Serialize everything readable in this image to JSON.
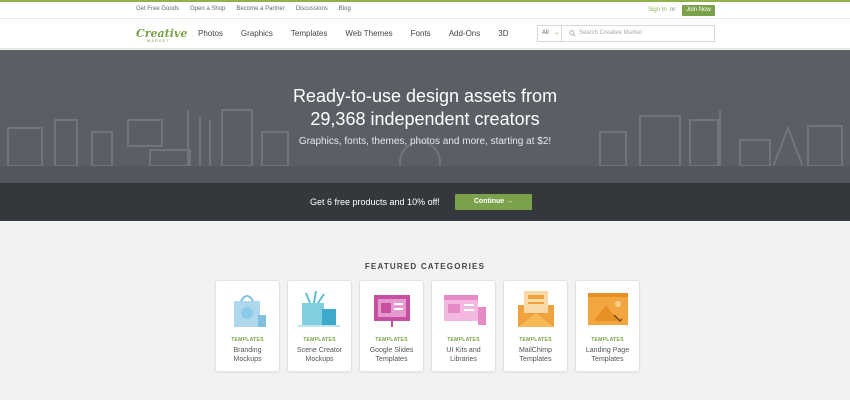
{
  "topbar": {
    "links": [
      "Get Free Goods",
      "Open a Shop",
      "Become a Partner",
      "Discussions",
      "Blog"
    ],
    "sign_in": "Sign In",
    "or": "or",
    "join": "Join Now"
  },
  "nav": {
    "logo_word": "Creative",
    "logo_sub": "MARKET",
    "items": [
      "Photos",
      "Graphics",
      "Templates",
      "Web Themes",
      "Fonts",
      "Add-Ons",
      "3D"
    ],
    "search_scope": "All",
    "search_placeholder": "Search Creative Market"
  },
  "hero": {
    "title_line1": "Ready-to-use design assets from",
    "title_line2": "29,368 independent creators",
    "subtitle": "Graphics, fonts, themes, photos and more, starting at $2!"
  },
  "promo": {
    "text": "Get 6 free products and 10% off!",
    "button": "Continue →"
  },
  "featured": {
    "heading": "FEATURED CATEGORIES",
    "cards": [
      {
        "kind": "TEMPLATES",
        "line1": "Branding",
        "line2": "Mockups",
        "icon": "shopping-bag-icon"
      },
      {
        "kind": "TEMPLATES",
        "line1": "Scene Creator",
        "line2": "Mockups",
        "icon": "scene-creator-icon"
      },
      {
        "kind": "TEMPLATES",
        "line1": "Google Slides",
        "line2": "Templates",
        "icon": "presentation-icon"
      },
      {
        "kind": "TEMPLATES",
        "line1": "UI Kits and",
        "line2": "Libraries",
        "icon": "ui-kit-icon"
      },
      {
        "kind": "TEMPLATES",
        "line1": "MailChimp",
        "line2": "Templates",
        "icon": "envelope-icon"
      },
      {
        "kind": "TEMPLATES",
        "line1": "Landing Page",
        "line2": "Templates",
        "icon": "landing-page-icon"
      }
    ]
  },
  "colors": {
    "brand_green": "#7ba14a",
    "hero_bg": "#5a5f66",
    "promo_bg": "#34383c"
  }
}
